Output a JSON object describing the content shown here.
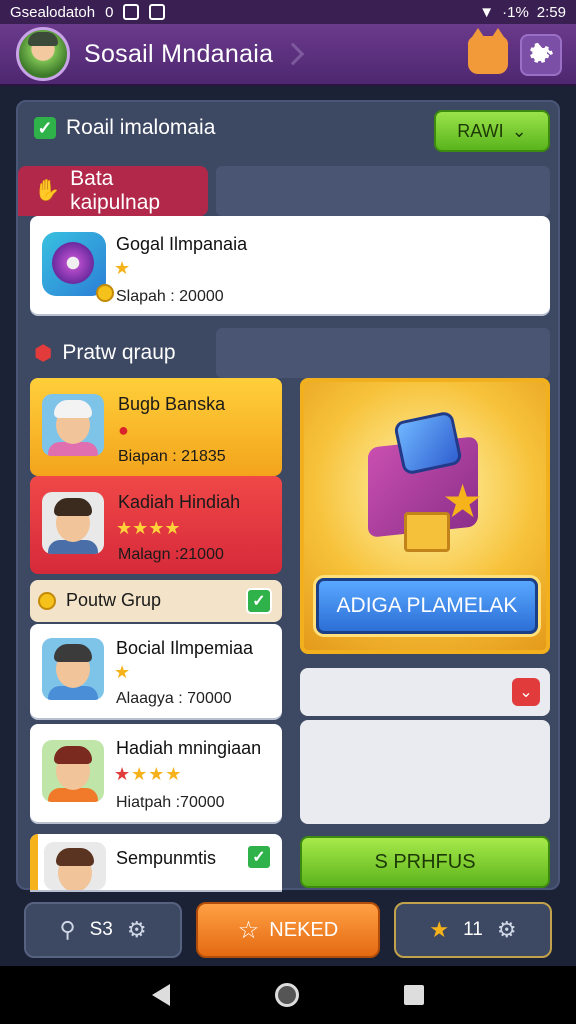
{
  "status_bar": {
    "left_text": "Gsealodatoh",
    "left_num": "0",
    "right_text": "·1%",
    "time": "2:59"
  },
  "header": {
    "title": "Sosail Mndanaia"
  },
  "section1": {
    "title": "Roail imalomaia",
    "button_label": "RAWI"
  },
  "section2": {
    "title": "Bata kaipulnap"
  },
  "top_card": {
    "name": "Gogal Ilmpanaia",
    "stat": "Slapah : 20000"
  },
  "section3": {
    "title": "Pratw qraup"
  },
  "group_cards": [
    {
      "name": "Bugb Banska",
      "stat": "Biapan : 21835"
    },
    {
      "name": "Kadiah Hindiah",
      "stat": "Malagn :21000"
    }
  ],
  "sub_section": {
    "title": "Poutw Grup"
  },
  "list_cards": [
    {
      "name": "Bocial Ilmpemiaa",
      "stat": "Alaagya : 70000"
    },
    {
      "name": "Hadiah mningiaan",
      "stat": "Hiatpah :70000"
    },
    {
      "name": "Sempunmtis"
    }
  ],
  "promo": {
    "button_label": "ADIGA PLAMELAK"
  },
  "green_button": {
    "label": "S PRHFUS"
  },
  "bottom_bar": {
    "left_count": "S3",
    "middle_label": "NEKED",
    "right_count": "11"
  },
  "colors": {
    "accent_purple": "#6b3a8c",
    "green": "#5ab41c",
    "red": "#b1284a",
    "orange": "#e46a12",
    "gold": "#f2b01f"
  }
}
